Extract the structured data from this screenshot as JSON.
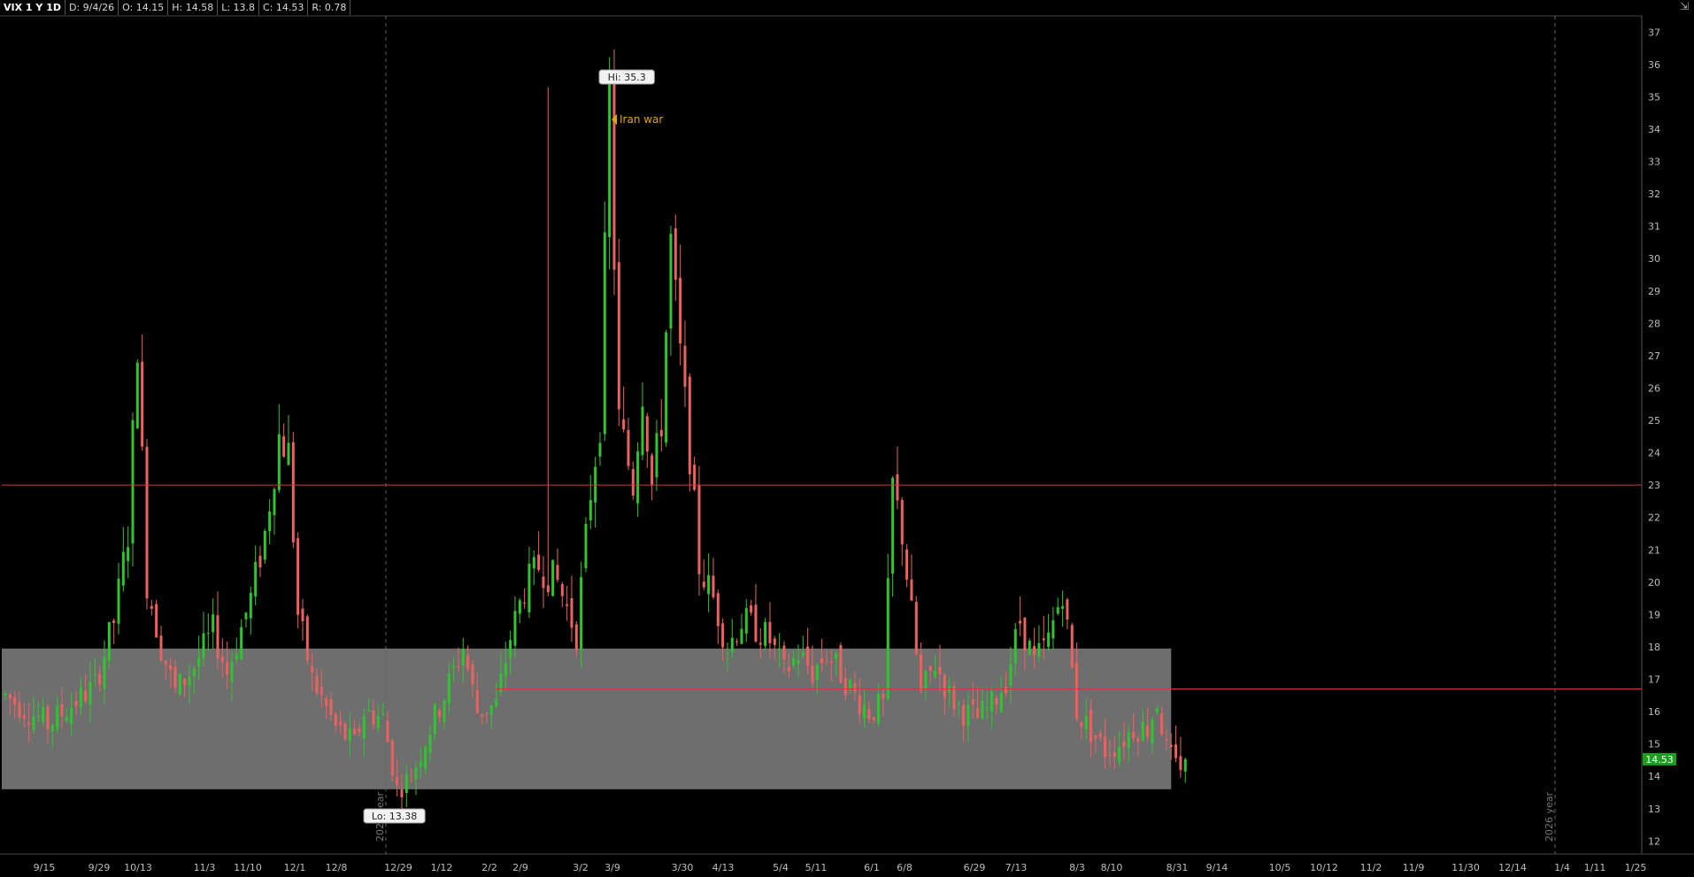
{
  "header": {
    "symbol": "VIX 1 Y 1D",
    "date": "D: 9/4/26",
    "open": "O: 14.15",
    "high": "H: 14.58",
    "low": "L: 13.8",
    "close": "C: 14.53",
    "range": "R: 0.78"
  },
  "icons": {
    "corner": "chart-settings-icon"
  },
  "colors": {
    "background": "#000000",
    "up_candle": "#2fc52f",
    "down_candle": "#ef6060",
    "level_line": "#d23a3a",
    "zone_fill": "#7a7a7a",
    "price_badge": "#1f9d1f",
    "annotation": "#e0a800",
    "axis_text": "#bdbdbd"
  },
  "chart_data": {
    "type": "candlestick",
    "title": "VIX 1 Y 1D",
    "ylim": [
      11.6,
      37.5
    ],
    "y_ticks": [
      12,
      13,
      14,
      15,
      16,
      17,
      18,
      19,
      20,
      21,
      22,
      23,
      24,
      25,
      26,
      27,
      28,
      29,
      30,
      31,
      32,
      33,
      34,
      35,
      36,
      37
    ],
    "x_tick_labels": [
      "9/15",
      "9/29",
      "10/13",
      "11/3",
      "11/10",
      "12/1",
      "12/8",
      "12/29",
      "1/12",
      "2/2",
      "2/9",
      "3/2",
      "3/9",
      "3/30",
      "4/13",
      "5/4",
      "5/11",
      "6/1",
      "6/8",
      "6/29",
      "7/13",
      "8/3",
      "8/10",
      "8/31",
      "9/14",
      "10/5",
      "10/12",
      "11/2",
      "11/9",
      "11/30",
      "12/14",
      "1/4",
      "1/11",
      "1/25"
    ],
    "year_separators": [
      {
        "label": "2026 year",
        "bar_index": 74
      },
      {
        "label": "2026 year",
        "bar_index": 300
      }
    ],
    "horizontal_levels": [
      {
        "value": 23.0,
        "from_bar": 0,
        "to": "end"
      },
      {
        "value": 16.7,
        "from_bar": 95,
        "to": "end"
      }
    ],
    "zone": {
      "low": 13.6,
      "high": 17.95,
      "from_bar": 0,
      "to_bar": 247
    },
    "annotations": [
      {
        "text": "Hi: 35.3",
        "bar_index": 115,
        "value": 35.3,
        "kind": "high"
      },
      {
        "text": "Lo: 13.38",
        "bar_index": 70,
        "value": 13.38,
        "kind": "low"
      },
      {
        "text": "Iran war",
        "bar_index": 118,
        "value": 34.3,
        "kind": "note"
      }
    ],
    "last_price": {
      "text": "14.53",
      "value": 14.53
    },
    "total_bars": 317,
    "anchors": [
      [
        0,
        16.5
      ],
      [
        5,
        16.0
      ],
      [
        9,
        15.6
      ],
      [
        14,
        16.2
      ],
      [
        19,
        16.8
      ],
      [
        23,
        18.8
      ],
      [
        26,
        21.5
      ],
      [
        28,
        27.5
      ],
      [
        30,
        20.0
      ],
      [
        33,
        18.0
      ],
      [
        36,
        16.6
      ],
      [
        40,
        17.4
      ],
      [
        44,
        18.5
      ],
      [
        47,
        17.2
      ],
      [
        52,
        19.5
      ],
      [
        55,
        21.5
      ],
      [
        58,
        24.5
      ],
      [
        60,
        24.0
      ],
      [
        62,
        19.0
      ],
      [
        65,
        17.0
      ],
      [
        70,
        15.5
      ],
      [
        74,
        15.0
      ],
      [
        76,
        16.0
      ],
      [
        80,
        15.8
      ],
      [
        83,
        13.6
      ],
      [
        86,
        14.0
      ],
      [
        90,
        15.5
      ],
      [
        93,
        16.5
      ],
      [
        97,
        18.0
      ],
      [
        100,
        16.0
      ],
      [
        104,
        16.2
      ],
      [
        107,
        18.3
      ],
      [
        110,
        19.8
      ],
      [
        113,
        20.5
      ],
      [
        117,
        20.0
      ],
      [
        121,
        18.4
      ],
      [
        124,
        22.8
      ],
      [
        126,
        25.0
      ],
      [
        128,
        35.0
      ],
      [
        130,
        25.0
      ],
      [
        133,
        23.0
      ],
      [
        135,
        26.0
      ],
      [
        137,
        23.0
      ],
      [
        139,
        25.0
      ],
      [
        141,
        30.5
      ],
      [
        143,
        27.0
      ],
      [
        145,
        24.0
      ],
      [
        147,
        20.5
      ],
      [
        150,
        19.5
      ],
      [
        153,
        18.0
      ],
      [
        156,
        18.8
      ],
      [
        159,
        18.6
      ],
      [
        162,
        18.2
      ],
      [
        165,
        17.2
      ],
      [
        168,
        17.8
      ],
      [
        171,
        17.2
      ],
      [
        174,
        17.8
      ],
      [
        177,
        17.2
      ],
      [
        180,
        16.5
      ],
      [
        183,
        16.0
      ],
      [
        186,
        16.2
      ],
      [
        188,
        23.0
      ],
      [
        190,
        21.5
      ],
      [
        192,
        19.0
      ],
      [
        194,
        16.5
      ],
      [
        197,
        17.5
      ],
      [
        200,
        16.5
      ],
      [
        203,
        16.0
      ],
      [
        206,
        15.8
      ],
      [
        209,
        16.2
      ],
      [
        212,
        17.0
      ],
      [
        215,
        18.8
      ],
      [
        218,
        17.5
      ],
      [
        221,
        18.2
      ],
      [
        224,
        19.8
      ],
      [
        227,
        16.0
      ],
      [
        230,
        15.4
      ],
      [
        233,
        14.8
      ],
      [
        236,
        15.0
      ],
      [
        239,
        15.5
      ],
      [
        242,
        15.5
      ],
      [
        244,
        16.3
      ],
      [
        246,
        14.8
      ],
      [
        248,
        14.3
      ],
      [
        250,
        14.53
      ]
    ],
    "ohlc": {
      "count": 251,
      "last": {
        "open": 14.15,
        "high": 14.58,
        "low": 13.8,
        "close": 14.53
      }
    }
  }
}
